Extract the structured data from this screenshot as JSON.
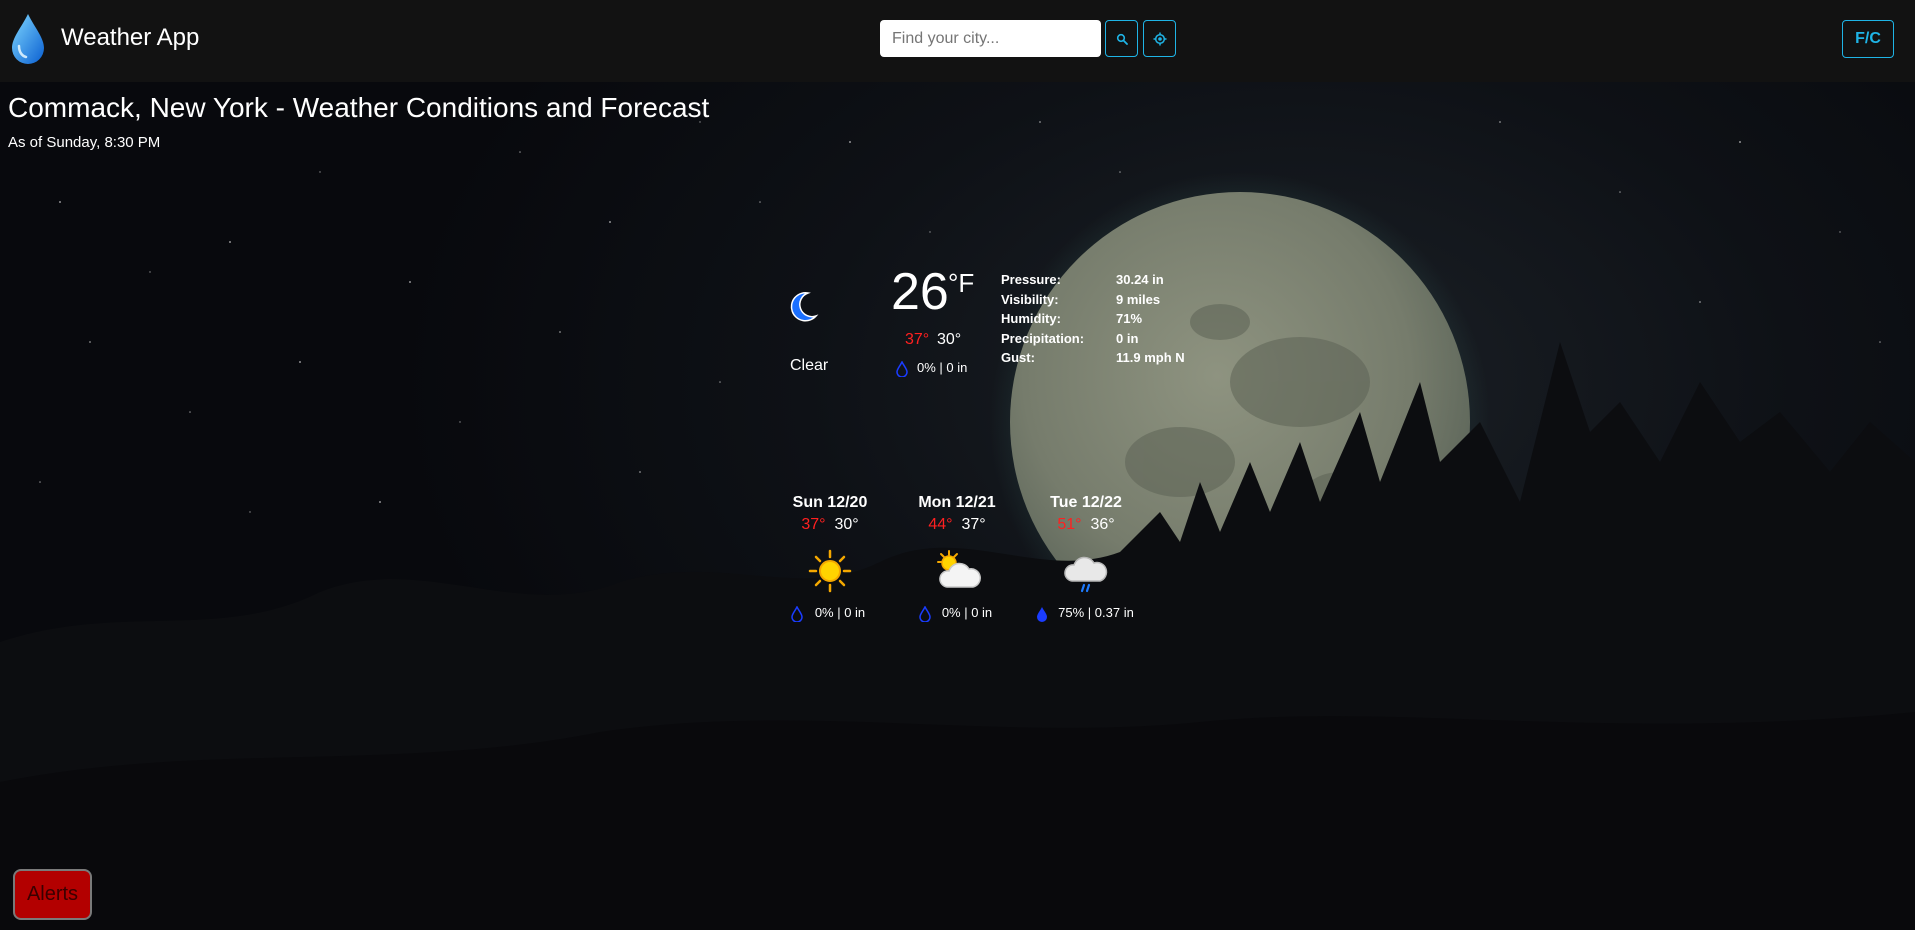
{
  "header": {
    "app_title": "Weather App",
    "search_placeholder": "Find your city...",
    "unit_toggle": "F/C",
    "accent_color": "#1fb4e6"
  },
  "location": {
    "title": "Commack, New York - Weather Conditions and Forecast",
    "as_of": "As of Sunday, 8:30 PM"
  },
  "current": {
    "icon": "moon-icon",
    "condition": "Clear",
    "temp": "26",
    "unit": "°F",
    "high": "37°",
    "low": "30°",
    "precip": "0% | 0 in",
    "details": [
      {
        "label": "Pressure:",
        "value": "30.24 in"
      },
      {
        "label": "Visibility:",
        "value": "9 miles"
      },
      {
        "label": "Humidity:",
        "value": "71%"
      },
      {
        "label": "Precipitation:",
        "value": "0 in"
      },
      {
        "label": "Gust:",
        "value": "11.9 mph N"
      }
    ]
  },
  "forecast": [
    {
      "day": "Sun 12/20",
      "high": "37°",
      "low": "30°",
      "icon": "sun-icon",
      "precip": "0% | 0 in"
    },
    {
      "day": "Mon 12/21",
      "high": "44°",
      "low": "37°",
      "icon": "partly-cloudy-icon",
      "precip": "0% | 0 in"
    },
    {
      "day": "Tue 12/22",
      "high": "51°",
      "low": "36°",
      "icon": "rain-cloud-icon",
      "precip": "75% | 0.37 in"
    }
  ],
  "alerts_label": "Alerts",
  "colors": {
    "high_temp": "#ff2020",
    "alerts_bg": "#b30000"
  }
}
